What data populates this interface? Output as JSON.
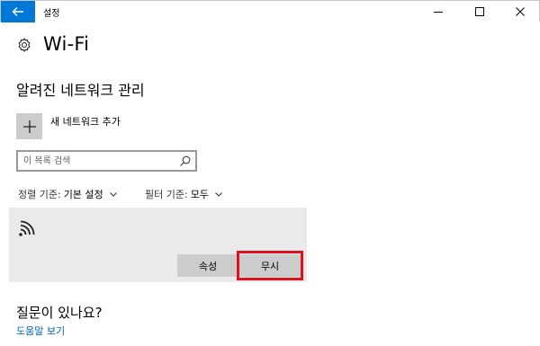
{
  "window": {
    "title": "설정"
  },
  "header": {
    "title": "Wi-Fi"
  },
  "manage": {
    "section_title": "알려진 네트워크 관리",
    "add_label": "새 네트워크 추가"
  },
  "search": {
    "placeholder": "이 목록 검색"
  },
  "sort": {
    "label": "정렬 기준:",
    "value": "기본 설정"
  },
  "filter": {
    "label": "필터 기준:",
    "value": "모두"
  },
  "network_card": {
    "properties_label": "속성",
    "forget_label": "무시"
  },
  "help": {
    "title": "질문이 있나요?",
    "link_label": "도움말 보기"
  },
  "colors": {
    "accent": "#0078d7",
    "link": "#0063b1",
    "highlight": "#e0101c"
  }
}
